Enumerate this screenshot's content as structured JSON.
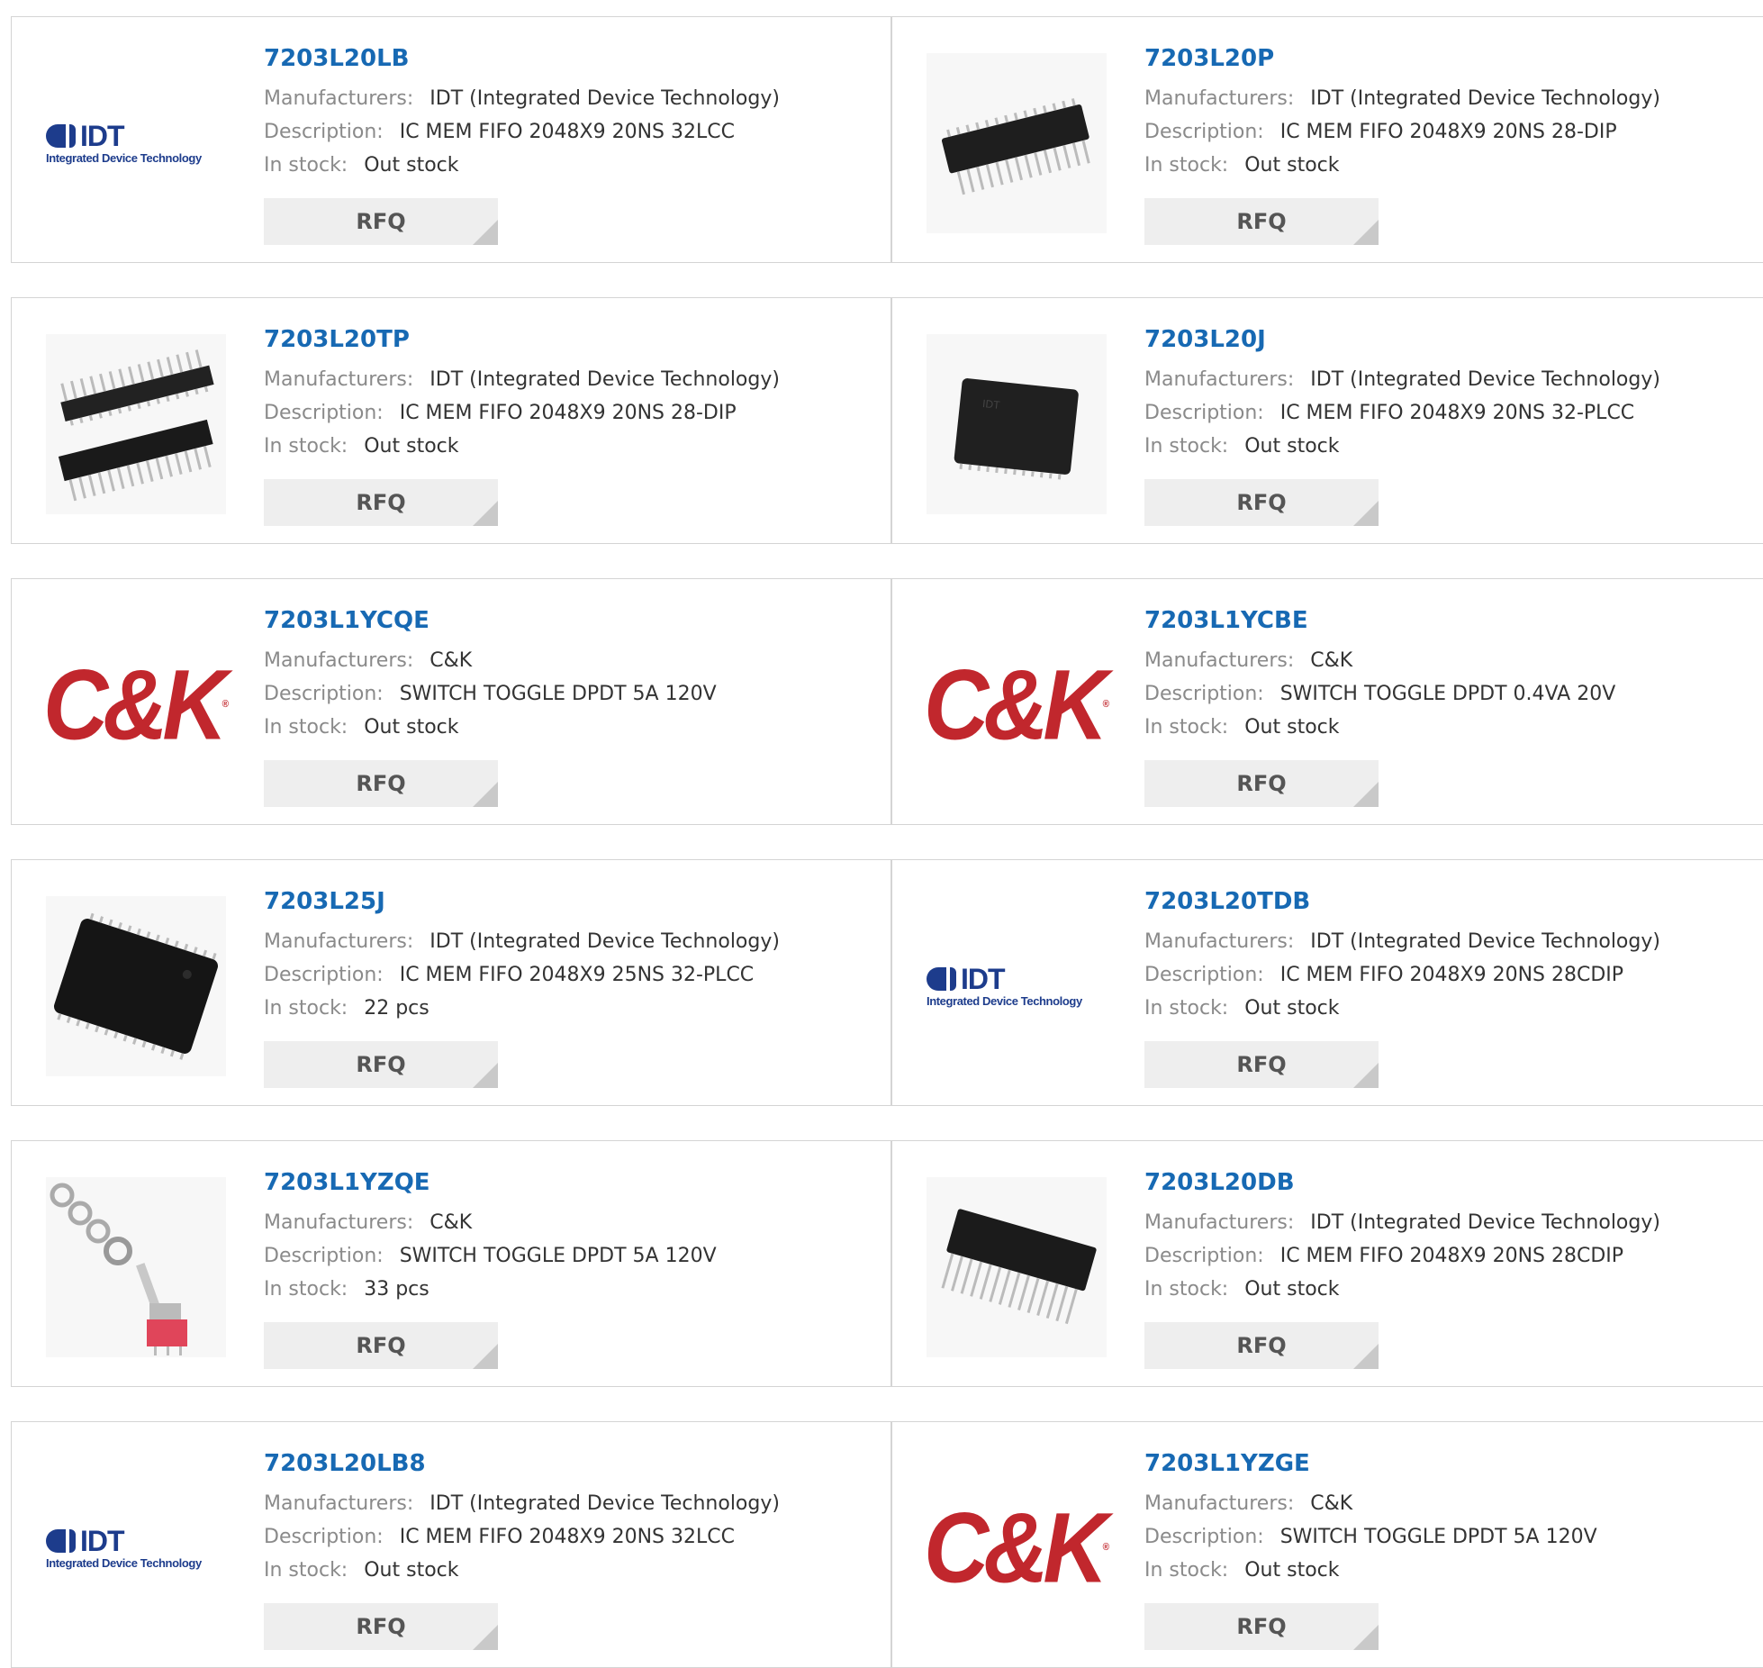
{
  "labels": {
    "manufacturers": "Manufacturers:",
    "description": "Description:",
    "in_stock": "In stock:",
    "rfq": "RFQ"
  },
  "logos": {
    "idt_name": "IDT",
    "idt_sub": "Integrated Device Technology",
    "ck_name": "C&K"
  },
  "products": [
    {
      "part": "7203L20LB",
      "manufacturer": "IDT (Integrated Device Technology)",
      "description": "IC MEM FIFO 2048X9 20NS 32LCC",
      "stock": "Out stock",
      "image": "idt-logo"
    },
    {
      "part": "7203L20P",
      "manufacturer": "IDT (Integrated Device Technology)",
      "description": "IC MEM FIFO 2048X9 20NS 28-DIP",
      "stock": "Out stock",
      "image": "dip-chip"
    },
    {
      "part": "7203L20TP",
      "manufacturer": "IDT (Integrated Device Technology)",
      "description": "IC MEM FIFO 2048X9 20NS 28-DIP",
      "stock": "Out stock",
      "image": "dip-pair"
    },
    {
      "part": "7203L20J",
      "manufacturer": "IDT (Integrated Device Technology)",
      "description": "IC MEM FIFO 2048X9 20NS 32-PLCC",
      "stock": "Out stock",
      "image": "plcc-chip"
    },
    {
      "part": "7203L1YCQE",
      "manufacturer": "C&K",
      "description": "SWITCH TOGGLE DPDT 5A 120V",
      "stock": "Out stock",
      "image": "ck-logo"
    },
    {
      "part": "7203L1YCBE",
      "manufacturer": "C&K",
      "description": "SWITCH TOGGLE DPDT 0.4VA 20V",
      "stock": "Out stock",
      "image": "ck-logo"
    },
    {
      "part": "7203L25J",
      "manufacturer": "IDT (Integrated Device Technology)",
      "description": "IC MEM FIFO 2048X9 25NS 32-PLCC",
      "stock": "22 pcs",
      "image": "plcc-large"
    },
    {
      "part": "7203L20TDB",
      "manufacturer": "IDT (Integrated Device Technology)",
      "description": "IC MEM FIFO 2048X9 20NS 28CDIP",
      "stock": "Out stock",
      "image": "idt-logo"
    },
    {
      "part": "7203L1YZQE",
      "manufacturer": "C&K",
      "description": "SWITCH TOGGLE DPDT 5A 120V",
      "stock": "33 pcs",
      "image": "toggle-switch"
    },
    {
      "part": "7203L20DB",
      "manufacturer": "IDT (Integrated Device Technology)",
      "description": "IC MEM FIFO 2048X9 20NS 28CDIP",
      "stock": "Out stock",
      "image": "cdip-chip"
    },
    {
      "part": "7203L20LB8",
      "manufacturer": "IDT (Integrated Device Technology)",
      "description": "IC MEM FIFO 2048X9 20NS 32LCC",
      "stock": "Out stock",
      "image": "idt-logo"
    },
    {
      "part": "7203L1YZGE",
      "manufacturer": "C&K",
      "description": "SWITCH TOGGLE DPDT 5A 120V",
      "stock": "Out stock",
      "image": "ck-logo"
    }
  ],
  "colors": {
    "part_link": "#1769b3",
    "label": "#8a8a8a",
    "value": "#333333",
    "rfq_bg": "#eeeeee",
    "idt_blue": "#1d3c8c",
    "ck_red": "#c1272d"
  }
}
